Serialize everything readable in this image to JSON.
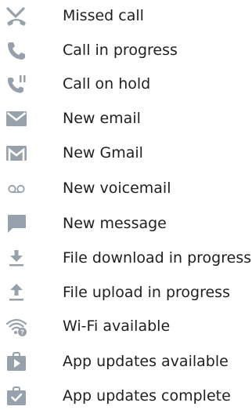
{
  "icon_color": "#97a1ab",
  "text_color": "#1f1f1f",
  "legend": {
    "items": [
      {
        "icon": "missed-call-icon",
        "label": "Missed call"
      },
      {
        "icon": "call-in-progress-icon",
        "label": "Call in progress"
      },
      {
        "icon": "call-on-hold-icon",
        "label": "Call on hold"
      },
      {
        "icon": "new-email-icon",
        "label": "New email"
      },
      {
        "icon": "new-gmail-icon",
        "label": "New Gmail"
      },
      {
        "icon": "new-voicemail-icon",
        "label": "New voicemail"
      },
      {
        "icon": "new-message-icon",
        "label": "New message"
      },
      {
        "icon": "file-download-icon",
        "label": "File download in progress"
      },
      {
        "icon": "file-upload-icon",
        "label": "File upload in progress"
      },
      {
        "icon": "wifi-available-icon",
        "label": "Wi-Fi available"
      },
      {
        "icon": "app-updates-available-icon",
        "label": "App updates available"
      },
      {
        "icon": "app-updates-complete-icon",
        "label": "App updates complete"
      }
    ]
  }
}
